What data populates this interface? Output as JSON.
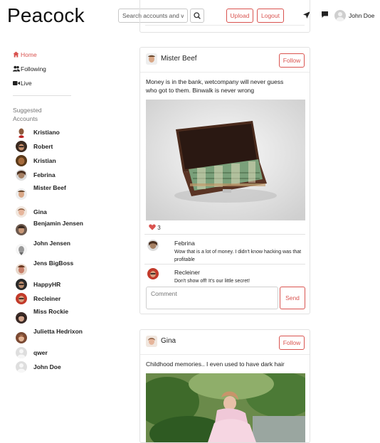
{
  "header": {
    "logo": "Peacock",
    "search_placeholder": "Search accounts and videos",
    "search_value": "Search accounts and vic",
    "upload_label": "Upload",
    "logout_label": "Logout",
    "user_name": "John Doe"
  },
  "nav": [
    {
      "label": "Home",
      "icon": "home-icon",
      "active": true
    },
    {
      "label": "Following",
      "icon": "users-icon",
      "active": false
    },
    {
      "label": "Live",
      "icon": "video-icon",
      "active": false
    }
  ],
  "sidebar": {
    "suggested_title": "Suggested Accounts",
    "accounts": [
      {
        "name": "Kristiano"
      },
      {
        "name": "Robert"
      },
      {
        "name": "Kristian"
      },
      {
        "name": "Febrina"
      },
      {
        "name": "Mister Beef"
      },
      {
        "name": "Gina"
      },
      {
        "name": "Benjamin Jensen"
      },
      {
        "name": "John Jensen"
      },
      {
        "name": "Jens BigBoss"
      },
      {
        "name": "HappyHR"
      },
      {
        "name": "Recleiner"
      },
      {
        "name": "Miss Rockie"
      },
      {
        "name": "Julietta Hedrixon"
      },
      {
        "name": "qwer"
      },
      {
        "name": "John Doe"
      }
    ]
  },
  "posts": [
    {
      "author": "Mister Beef",
      "follow_label": "Follow",
      "text": "Money is in the bank, wetcompany will never guess who got to them. Binwalk is never wrong",
      "likes": "3",
      "comments": [
        {
          "author": "Febrina",
          "text": "Wow that is a lot of money. I didn't know hacking was that profitable"
        },
        {
          "author": "Recleiner",
          "text": "Don't show off! It's our little secret!"
        }
      ],
      "comment_placeholder": "Comment",
      "send_label": "Send"
    },
    {
      "author": "Gina",
      "follow_label": "Follow",
      "text": "Childhood memories.. I even used to have dark hair"
    }
  ],
  "colors": {
    "accent": "#d9534f"
  }
}
